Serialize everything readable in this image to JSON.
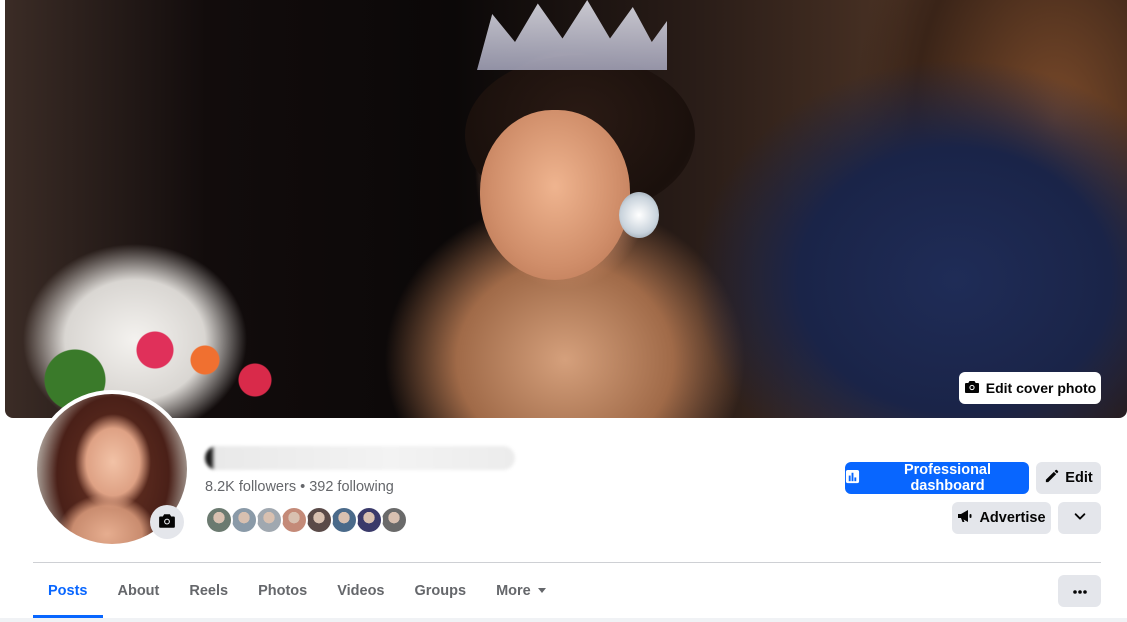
{
  "cover": {
    "edit_label": "Edit cover photo",
    "icon": "camera-icon"
  },
  "profile": {
    "followers_text": "8.2K followers • 392 following",
    "friend_faces": [
      "#6b7a70",
      "#8a9aa8",
      "#a0a8b0",
      "#c48a78",
      "#5a4a48",
      "#4a6a8a",
      "#3a3a6a",
      "#6a6a6a"
    ]
  },
  "actions": {
    "dashboard_label": "Professional dashboard",
    "edit_label": "Edit",
    "advertise_label": "Advertise"
  },
  "tabs": [
    {
      "label": "Posts",
      "active": true
    },
    {
      "label": "About"
    },
    {
      "label": "Reels"
    },
    {
      "label": "Photos"
    },
    {
      "label": "Videos"
    },
    {
      "label": "Groups"
    },
    {
      "label": "More"
    }
  ],
  "colors": {
    "accent": "#0866ff",
    "secondary_button": "#e4e6eb",
    "muted_text": "#65676b"
  }
}
